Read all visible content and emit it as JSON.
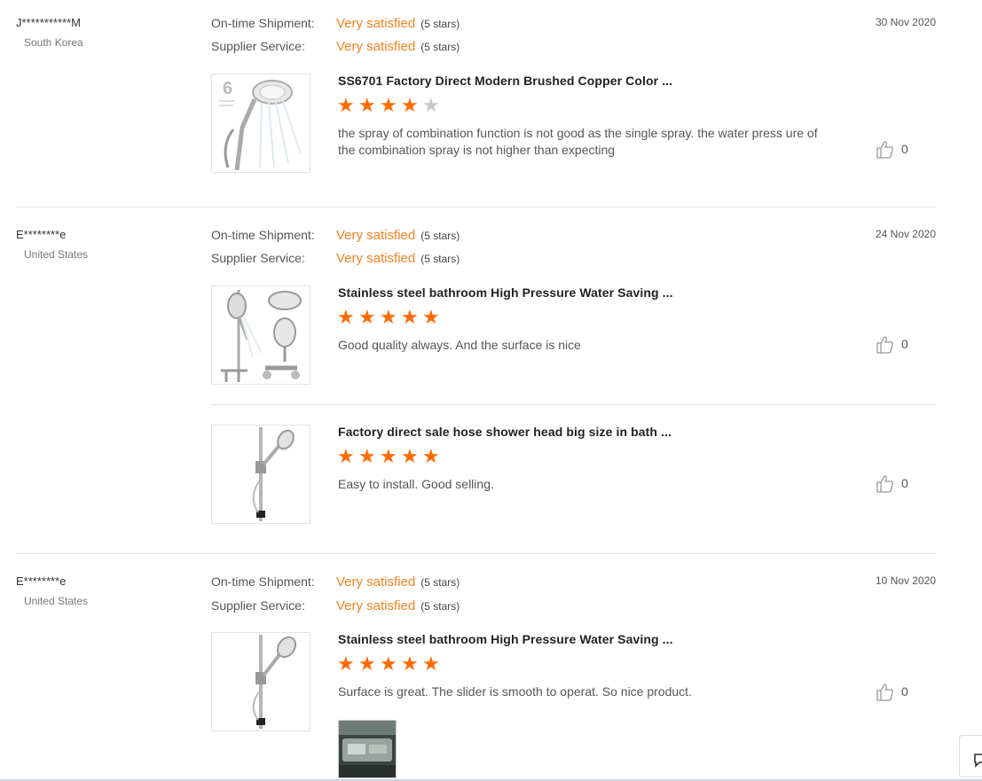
{
  "reviews": [
    {
      "buyer": "J***********M",
      "country": "South Korea",
      "date": "30 Nov 2020",
      "shipment_label": "On-time Shipment:",
      "shipment_value": "Very satisfied",
      "shipment_note": "(5 stars)",
      "service_label": "Supplier Service:",
      "service_value": "Very satisfied",
      "service_note": "(5 stars)",
      "products": [
        {
          "title": "SS6701 Factory Direct Modern Brushed Copper Color ...",
          "rating": 4,
          "comment": "the spray of combination function is not good as the single spray. the water press ure of the combination spray is not higher than expecting",
          "likes": "0",
          "image_icon": "handheld-shower-head-image"
        }
      ]
    },
    {
      "buyer": "E********e",
      "country": "United States",
      "date": "24 Nov 2020",
      "shipment_label": "On-time Shipment:",
      "shipment_value": "Very satisfied",
      "shipment_note": "(5 stars)",
      "service_label": "Supplier Service:",
      "service_value": "Very satisfied",
      "service_note": "(5 stars)",
      "products": [
        {
          "title": "Stainless steel bathroom High Pressure Water Saving ...",
          "rating": 5,
          "comment": "Good quality always. And the surface is nice",
          "likes": "0",
          "image_icon": "shower-system-image"
        },
        {
          "title": "Factory direct sale hose shower head big size in bath ...",
          "rating": 5,
          "comment": "Easy to install. Good selling.",
          "likes": "0",
          "image_icon": "slide-bar-shower-image"
        }
      ]
    },
    {
      "buyer": "E********e",
      "country": "United States",
      "date": "10 Nov 2020",
      "shipment_label": "On-time Shipment:",
      "shipment_value": "Very satisfied",
      "shipment_note": "(5 stars)",
      "service_label": "Supplier Service:",
      "service_value": "Very satisfied",
      "service_note": "(5 stars)",
      "products": [
        {
          "title": "Stainless steel bathroom High Pressure Water Saving ...",
          "rating": 5,
          "comment": "Surface is great. The slider is smooth to operat. So nice product.",
          "likes": "0",
          "image_icon": "slide-bar-shower-image"
        }
      ]
    }
  ],
  "thumb1_badge": "6",
  "colors": {
    "accent": "#f5821f",
    "star_on": "#ff6a00",
    "star_off": "#c8c8c8"
  }
}
